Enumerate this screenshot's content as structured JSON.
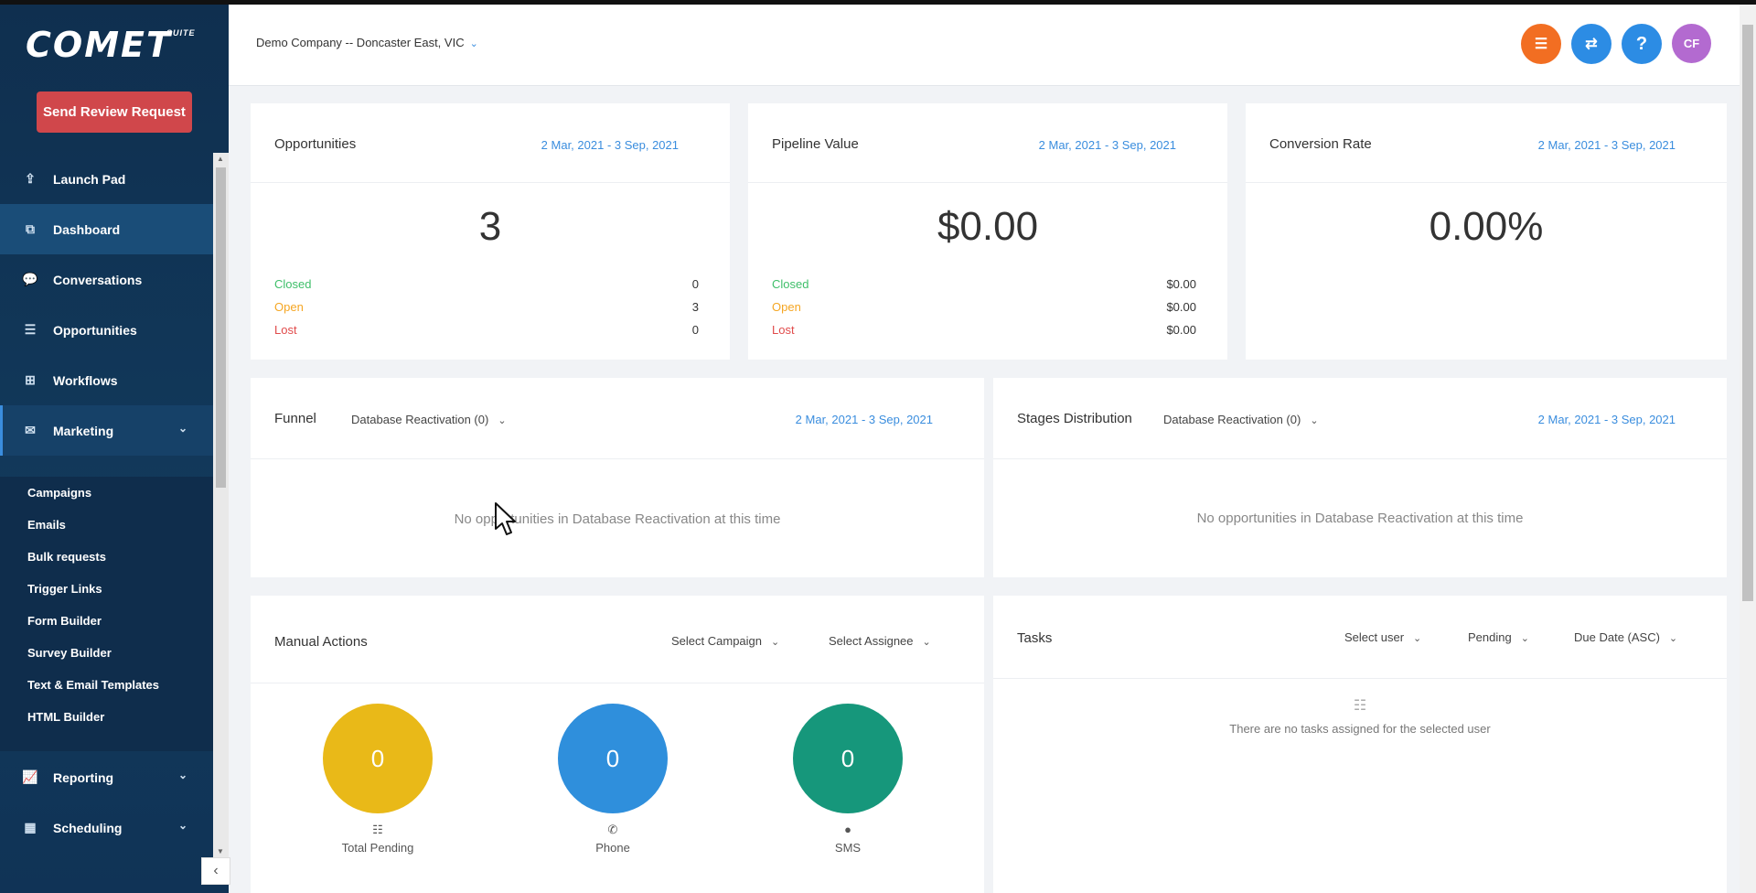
{
  "brand": {
    "logo": "COMET",
    "suite": "SUITE"
  },
  "sidebar": {
    "review_button": "Send Review Request",
    "items": [
      {
        "label": "Launch Pad",
        "icon": "rocket-icon"
      },
      {
        "label": "Dashboard",
        "icon": "dashboard-icon"
      },
      {
        "label": "Conversations",
        "icon": "chat-icon"
      },
      {
        "label": "Opportunities",
        "icon": "opportunities-icon"
      },
      {
        "label": "Workflows",
        "icon": "workflow-icon"
      },
      {
        "label": "Marketing",
        "icon": "mail-icon"
      }
    ],
    "marketing_sub": [
      "Campaigns",
      "Emails",
      "Bulk requests",
      "Trigger Links",
      "Form Builder",
      "Survey Builder",
      "Text & Email Templates",
      "HTML Builder"
    ],
    "bottom_items": [
      {
        "label": "Reporting",
        "icon": "chart-icon"
      },
      {
        "label": "Scheduling",
        "icon": "calendar-icon"
      }
    ]
  },
  "topbar": {
    "location": "Demo Company -- Doncaster East, VIC",
    "avatar_initials": "CF",
    "help": "?"
  },
  "opportunities": {
    "title": "Opportunities",
    "date": "2 Mar, 2021 - 3 Sep, 2021",
    "total": "3",
    "closed_label": "Closed",
    "closed": "0",
    "open_label": "Open",
    "open": "3",
    "lost_label": "Lost",
    "lost": "0"
  },
  "pipeline": {
    "title": "Pipeline Value",
    "date": "2 Mar, 2021 - 3 Sep, 2021",
    "total": "$0.00",
    "closed_label": "Closed",
    "closed": "$0.00",
    "open_label": "Open",
    "open": "$0.00",
    "lost_label": "Lost",
    "lost": "$0.00"
  },
  "conversion": {
    "title": "Conversion Rate",
    "date": "2 Mar, 2021 - 3 Sep, 2021",
    "total": "0.00%"
  },
  "funnel": {
    "title": "Funnel",
    "pipeline": "Database Reactivation (0)",
    "date": "2 Mar, 2021 - 3 Sep, 2021",
    "empty": "No opportunities in Database Reactivation at this time"
  },
  "stages": {
    "title": "Stages Distribution",
    "pipeline": "Database Reactivation (0)",
    "date": "2 Mar, 2021 - 3 Sep, 2021",
    "empty": "No opportunities in Database Reactivation at this time"
  },
  "manual_actions": {
    "title": "Manual Actions",
    "campaign": "Select Campaign",
    "assignee": "Select Assignee",
    "total_pending": "0",
    "total_label": "Total Pending",
    "phone": "0",
    "phone_label": "Phone",
    "sms": "0",
    "sms_label": "SMS",
    "colors": {
      "pending": "#e9b918",
      "phone": "#2f8fdc",
      "sms": "#16977b"
    }
  },
  "tasks": {
    "title": "Tasks",
    "user": "Select user",
    "status": "Pending",
    "sort": "Due Date (ASC)",
    "empty": "There are no tasks assigned for the selected user"
  }
}
